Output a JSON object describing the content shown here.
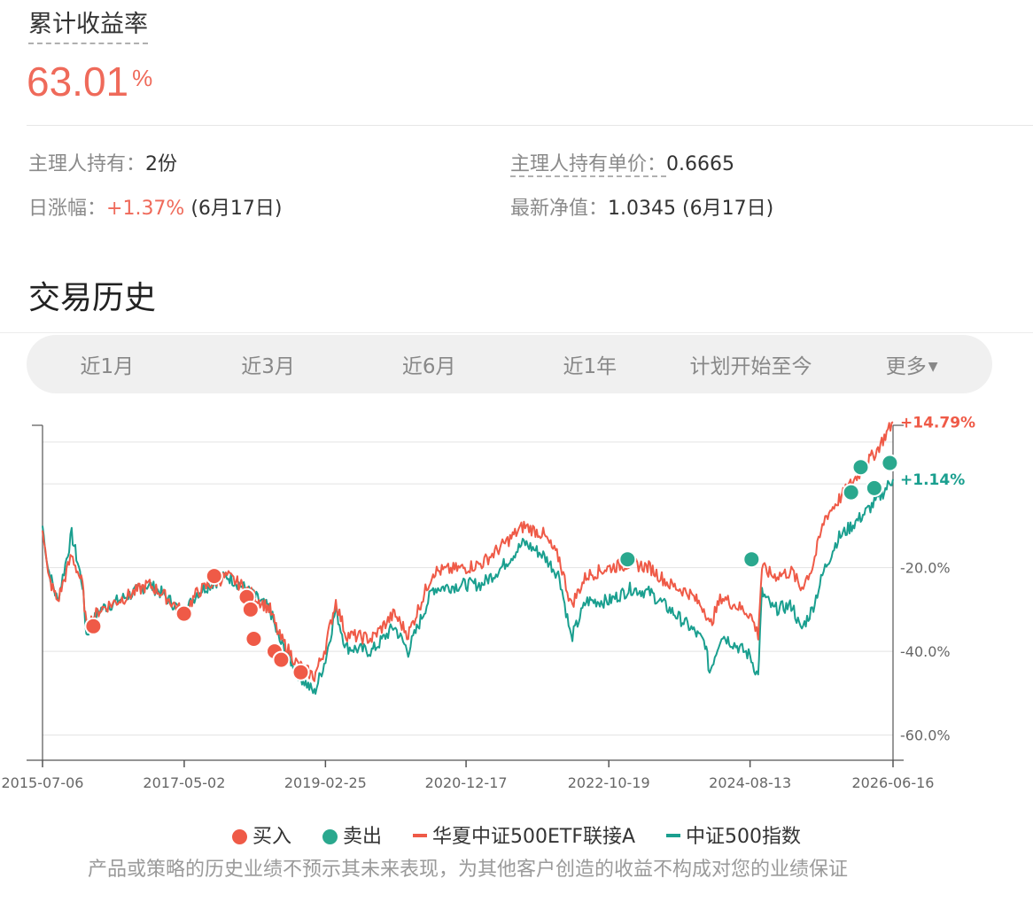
{
  "summary": {
    "cumulative_label": "累计收益率",
    "cumulative_value": "63.01",
    "cumulative_unit": "%"
  },
  "info": {
    "holding_label": "主理人持有：",
    "holding_value": "2份",
    "unit_price_label": "主理人持有单价：",
    "unit_price_value": "0.6665",
    "daily_change_label": "日涨幅：",
    "daily_change_value": "+1.37%",
    "daily_change_date": "(6月17日)",
    "nav_label": "最新净值：",
    "nav_value": "1.0345",
    "nav_date": "(6月17日)"
  },
  "section": {
    "title": "交易历史"
  },
  "tabs": [
    {
      "label": "近1月"
    },
    {
      "label": "近3月"
    },
    {
      "label": "近6月"
    },
    {
      "label": "近1年"
    },
    {
      "label": "计划开始至今"
    },
    {
      "label": "更多"
    }
  ],
  "tabs_more_caret": "▼",
  "chart_data": {
    "type": "line",
    "x_ticks": [
      "2015-07-06",
      "2017-05-02",
      "2019-02-25",
      "2020-12-17",
      "2022-10-19",
      "2024-08-13",
      "2026-06-16"
    ],
    "y_ticks": [
      "-20.0%",
      "-40.0%",
      "-60.0%"
    ],
    "y_tick_values": [
      -20,
      -40,
      -60
    ],
    "ylim": [
      -66,
      14
    ],
    "series": [
      {
        "name": "华夏中证500ETF联接A",
        "color": "#ef5a47",
        "end_label": "+14.79%",
        "points": [
          [
            "2015-07-06",
            -10
          ],
          [
            "2015-08-01",
            -22
          ],
          [
            "2015-09-15",
            -28
          ],
          [
            "2015-11-20",
            -17
          ],
          [
            "2016-01-10",
            -24
          ],
          [
            "2016-01-28",
            -34
          ],
          [
            "2016-04-01",
            -30
          ],
          [
            "2016-08-01",
            -27
          ],
          [
            "2016-11-15",
            -24
          ],
          [
            "2017-01-15",
            -26
          ],
          [
            "2017-05-02",
            -31
          ],
          [
            "2017-07-01",
            -26
          ],
          [
            "2017-09-01",
            -24
          ],
          [
            "2017-11-20",
            -22
          ],
          [
            "2018-01-20",
            -24
          ],
          [
            "2018-04-01",
            -27
          ],
          [
            "2018-06-10",
            -30
          ],
          [
            "2018-07-20",
            -36
          ],
          [
            "2018-10-15",
            -43
          ],
          [
            "2019-01-04",
            -46
          ],
          [
            "2019-02-25",
            -39
          ],
          [
            "2019-04-15",
            -28
          ],
          [
            "2019-06-01",
            -36
          ],
          [
            "2019-10-01",
            -37
          ],
          [
            "2020-01-15",
            -31
          ],
          [
            "2020-03-20",
            -36
          ],
          [
            "2020-07-15",
            -21
          ],
          [
            "2020-12-17",
            -20
          ],
          [
            "2021-03-01",
            -19
          ],
          [
            "2021-06-01",
            -15
          ],
          [
            "2021-09-15",
            -10
          ],
          [
            "2021-12-15",
            -12
          ],
          [
            "2022-03-01",
            -18
          ],
          [
            "2022-04-26",
            -29
          ],
          [
            "2022-07-05",
            -22
          ],
          [
            "2022-10-19",
            -20
          ],
          [
            "2023-02-01",
            -19
          ],
          [
            "2023-05-01",
            -20
          ],
          [
            "2023-08-01",
            -24
          ],
          [
            "2023-10-31",
            -26
          ],
          [
            "2024-01-15",
            -30
          ],
          [
            "2024-02-05",
            -34
          ],
          [
            "2024-04-01",
            -27
          ],
          [
            "2024-08-13",
            -31
          ],
          [
            "2024-09-20",
            -36
          ],
          [
            "2024-10-08",
            -20
          ],
          [
            "2024-12-01",
            -22
          ],
          [
            "2025-03-01",
            -21
          ],
          [
            "2025-04-08",
            -25
          ],
          [
            "2025-06-01",
            -20
          ],
          [
            "2025-08-01",
            -8
          ],
          [
            "2025-10-01",
            -4
          ],
          [
            "2026-01-15",
            3
          ],
          [
            "2026-04-01",
            8
          ],
          [
            "2026-06-16",
            14.79
          ]
        ]
      },
      {
        "name": "中证500指数",
        "color": "#1a9f8f",
        "end_label": "+1.14%",
        "points": [
          [
            "2015-07-06",
            -10
          ],
          [
            "2015-08-01",
            -20
          ],
          [
            "2015-09-15",
            -28
          ],
          [
            "2015-11-20",
            -12
          ],
          [
            "2016-01-10",
            -24
          ],
          [
            "2016-01-28",
            -36
          ],
          [
            "2016-04-01",
            -30
          ],
          [
            "2016-08-01",
            -27
          ],
          [
            "2016-11-15",
            -24
          ],
          [
            "2017-01-15",
            -26
          ],
          [
            "2017-05-02",
            -31
          ],
          [
            "2017-07-01",
            -26
          ],
          [
            "2017-09-01",
            -24
          ],
          [
            "2017-11-20",
            -22
          ],
          [
            "2018-01-20",
            -24
          ],
          [
            "2018-04-01",
            -27
          ],
          [
            "2018-06-10",
            -30
          ],
          [
            "2018-07-20",
            -37
          ],
          [
            "2018-10-15",
            -45
          ],
          [
            "2019-01-04",
            -50
          ],
          [
            "2019-02-25",
            -42
          ],
          [
            "2019-04-15",
            -30
          ],
          [
            "2019-06-01",
            -39
          ],
          [
            "2019-10-01",
            -40
          ],
          [
            "2020-01-15",
            -34
          ],
          [
            "2020-03-20",
            -40
          ],
          [
            "2020-07-15",
            -25
          ],
          [
            "2020-12-17",
            -24
          ],
          [
            "2021-03-01",
            -24
          ],
          [
            "2021-06-01",
            -20
          ],
          [
            "2021-09-15",
            -14
          ],
          [
            "2021-12-15",
            -17
          ],
          [
            "2022-03-01",
            -22
          ],
          [
            "2022-04-26",
            -37
          ],
          [
            "2022-07-05",
            -28
          ],
          [
            "2022-10-19",
            -28
          ],
          [
            "2023-02-01",
            -25
          ],
          [
            "2023-05-01",
            -26
          ],
          [
            "2023-08-01",
            -30
          ],
          [
            "2023-10-31",
            -34
          ],
          [
            "2024-01-15",
            -38
          ],
          [
            "2024-02-05",
            -45
          ],
          [
            "2024-04-01",
            -36
          ],
          [
            "2024-08-13",
            -41
          ],
          [
            "2024-09-20",
            -46
          ],
          [
            "2024-10-08",
            -26
          ],
          [
            "2024-12-01",
            -30
          ],
          [
            "2025-03-01",
            -29
          ],
          [
            "2025-04-08",
            -35
          ],
          [
            "2025-06-01",
            -30
          ],
          [
            "2025-08-01",
            -20
          ],
          [
            "2025-10-01",
            -13
          ],
          [
            "2026-01-15",
            -8
          ],
          [
            "2026-04-01",
            -4
          ],
          [
            "2026-06-16",
            1.14
          ]
        ]
      }
    ],
    "buy_points": [
      [
        "2016-03-01",
        -34
      ],
      [
        "2017-05-01",
        -31
      ],
      [
        "2017-09-20",
        -22
      ],
      [
        "2018-02-20",
        -27
      ],
      [
        "2018-03-10",
        -30
      ],
      [
        "2018-03-25",
        -37
      ],
      [
        "2018-07-01",
        -40
      ],
      [
        "2018-08-01",
        -42
      ],
      [
        "2018-11-01",
        -45
      ]
    ],
    "sell_points": [
      [
        "2023-01-15",
        -18
      ],
      [
        "2024-08-20",
        -18
      ],
      [
        "2025-12-01",
        -2
      ],
      [
        "2026-01-15",
        4
      ],
      [
        "2026-03-20",
        -1
      ],
      [
        "2026-06-01",
        5
      ]
    ],
    "buy_color": "#ef5a47",
    "sell_color": "#2aa88e"
  },
  "legend": {
    "buy": "买入",
    "sell": "卖出",
    "fund": "华夏中证500ETF联接A",
    "index": "中证500指数"
  },
  "disclaimer": "产品或策略的历史业绩不预示其未来表现，为其他客户创造的收益不构成对您的业绩保证"
}
